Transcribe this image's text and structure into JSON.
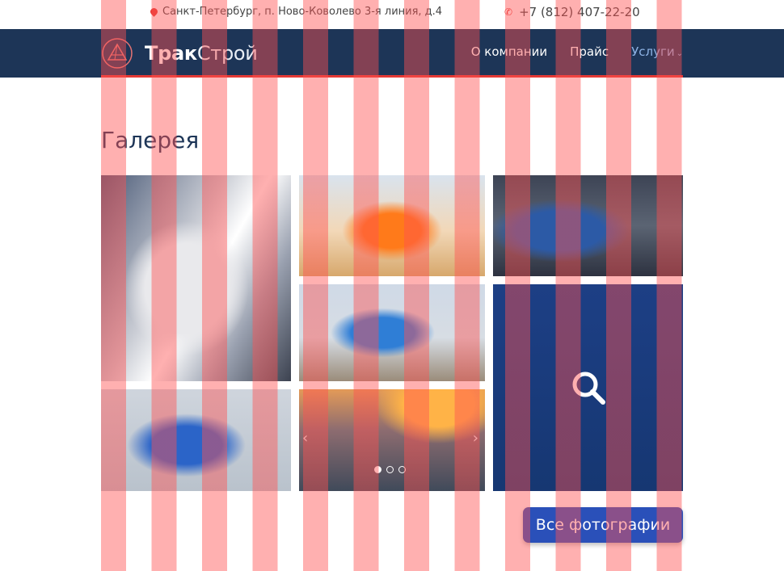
{
  "topbar": {
    "address": "Санкт-Петербург, п. Ново-Ковoлево 3-я линия, д.4",
    "phone": "+7 (812) 407-22-20"
  },
  "header": {
    "logo_part1": "Трак",
    "logo_part2": "Строй",
    "nav": [
      {
        "label": "О компании"
      },
      {
        "label": "Прайс"
      },
      {
        "label": "Услуги"
      }
    ]
  },
  "gallery": {
    "title": "Галерея",
    "slider": {
      "prev": "‹",
      "next": "›",
      "active_slide": 1,
      "total_slides": 3
    },
    "all_photos_label": "Все фотографии"
  },
  "colors": {
    "header_bg": "#1d3557",
    "accent": "#e53935",
    "button": "#2a50b9",
    "stripe_overlay": "#ff5050"
  }
}
